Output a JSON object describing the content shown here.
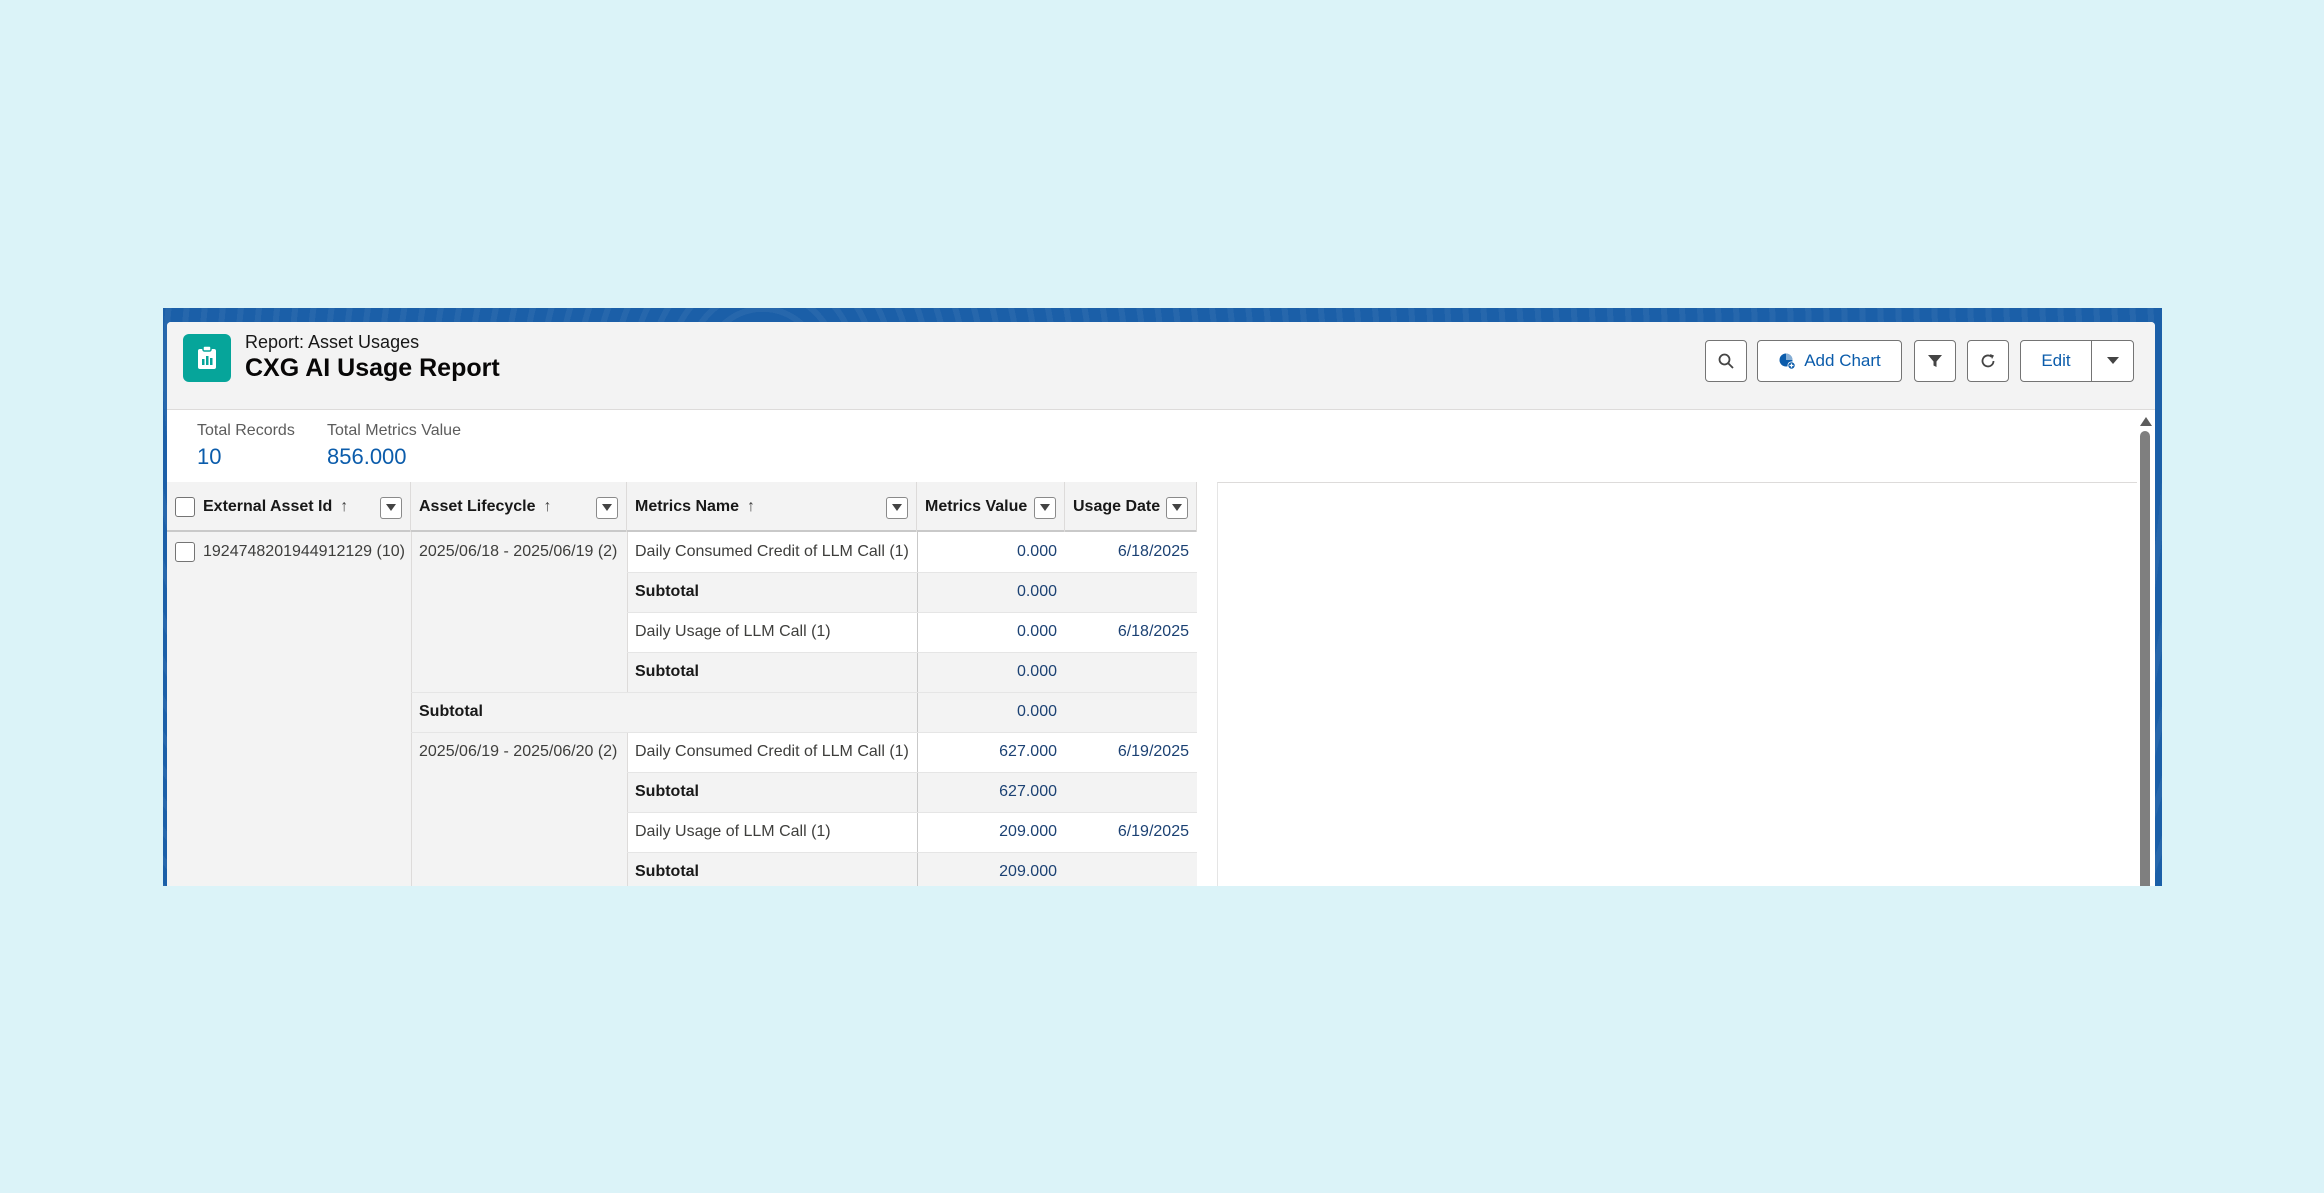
{
  "header": {
    "eyebrow": "Report: Asset Usages",
    "title": "CXG AI Usage Report",
    "icon": "report-icon",
    "add_chart_label": "Add Chart",
    "edit_label": "Edit"
  },
  "summary": {
    "total_records_label": "Total Records",
    "total_records_value": "10",
    "total_metrics_label": "Total Metrics Value",
    "total_metrics_value": "856.000"
  },
  "table": {
    "columns": [
      "External Asset Id",
      "Asset Lifecycle",
      "Metrics Name",
      "Metrics Value",
      "Usage Date"
    ],
    "sort_arrow": "↑",
    "external_asset_id": "1924748201944912129 (10)",
    "groups": [
      {
        "lifecycle": "2025/06/18 - 2025/06/19 (2)",
        "rows": [
          {
            "name": "Daily Consumed Credit of LLM Call (1)",
            "value": "0.000",
            "date": "6/18/2025",
            "subtotal": "0.000"
          },
          {
            "name": "Daily Usage of LLM Call (1)",
            "value": "0.000",
            "date": "6/18/2025",
            "subtotal": "0.000"
          }
        ],
        "subtotal": "0.000"
      },
      {
        "lifecycle": "2025/06/19 - 2025/06/20 (2)",
        "rows": [
          {
            "name": "Daily Consumed Credit of LLM Call (1)",
            "value": "627.000",
            "date": "6/19/2025",
            "subtotal": "627.000"
          },
          {
            "name": "Daily Usage of LLM Call (1)",
            "value": "209.000",
            "date": "6/19/2025",
            "subtotal": "209.000"
          }
        ]
      }
    ],
    "subtotal_label": "Subtotal"
  },
  "colors": {
    "brand_blue": "#0b5cab",
    "icon_teal": "#06a59a",
    "frame_blue": "#1b5fa8",
    "background": "#dbf3f8"
  }
}
